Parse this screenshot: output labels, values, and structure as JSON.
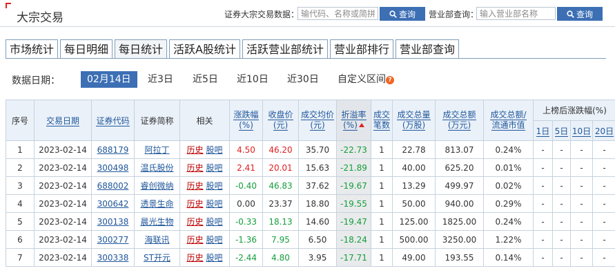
{
  "header": {
    "title": "大宗交易",
    "search1_label": "证券大宗交易数据：",
    "search1_placeholder": "输代码、名称或简拼",
    "search1_button": "查询",
    "search2_label": "营业部查询：",
    "search2_placeholder": "输入营业部名称",
    "search2_button": "查询"
  },
  "tabs": [
    {
      "label": "市场统计",
      "active": false
    },
    {
      "label": "每日明细",
      "active": false
    },
    {
      "label": "每日统计",
      "active": true
    },
    {
      "label": "活跃A股统计",
      "active": false
    },
    {
      "label": "活跃营业部统计",
      "active": false
    },
    {
      "label": "营业部排行",
      "active": false
    },
    {
      "label": "营业部查询",
      "active": false
    }
  ],
  "date_filter": {
    "label": "数据日期：",
    "options": [
      "02月14日",
      "近3日",
      "近5日",
      "近10日",
      "近30日",
      "自定义区间"
    ],
    "selected": "02月14日"
  },
  "table": {
    "headers": {
      "seq": "序号",
      "date": "交易日期",
      "code": "证券代码",
      "name": "证券简称",
      "related": "相关",
      "change": "涨跌幅\n(%)",
      "close": "收盘价\n(元)",
      "avg_price": "成交均价\n(元)",
      "discount": "折溢率\n(%)",
      "deals": "成交\n笔数",
      "volume": "成交总量\n(万股)",
      "amount": "成交总额\n(万元)",
      "ratio": "成交总额/\n流通市值",
      "post": "上榜后涨跌幅(%)",
      "post_1d": "1日",
      "post_5d": "5日",
      "post_10d": "10日",
      "post_20d": "20日"
    },
    "rows": [
      {
        "seq": "1",
        "date": "2023-02-14",
        "code": "688179",
        "name": "阿拉丁",
        "hist": "历史",
        "guba": "股吧",
        "change": "4.50",
        "close": "46.20",
        "avg": "35.70",
        "discount": "-22.73",
        "deals": "1",
        "volume": "22.78",
        "amount": "813.07",
        "ratio": "0.24%",
        "d1": "-",
        "d5": "-",
        "d10": "-",
        "d20": "-",
        "dir": "up"
      },
      {
        "seq": "2",
        "date": "2023-02-14",
        "code": "300498",
        "name": "温氏股份",
        "hist": "历史",
        "guba": "股吧",
        "change": "2.41",
        "close": "20.01",
        "avg": "15.63",
        "discount": "-21.89",
        "deals": "1",
        "volume": "40.00",
        "amount": "625.20",
        "ratio": "0.01%",
        "d1": "-",
        "d5": "-",
        "d10": "-",
        "d20": "-",
        "dir": "up"
      },
      {
        "seq": "3",
        "date": "2023-02-14",
        "code": "688002",
        "name": "睿创微纳",
        "hist": "历史",
        "guba": "股吧",
        "change": "-0.40",
        "close": "46.83",
        "avg": "37.62",
        "discount": "-19.67",
        "deals": "1",
        "volume": "13.29",
        "amount": "499.97",
        "ratio": "0.02%",
        "d1": "-",
        "d5": "-",
        "d10": "-",
        "d20": "-",
        "dir": "down"
      },
      {
        "seq": "4",
        "date": "2023-02-14",
        "code": "300642",
        "name": "透景生命",
        "hist": "历史",
        "guba": "股吧",
        "change": "0.00",
        "close": "23.37",
        "avg": "18.80",
        "discount": "-19.55",
        "deals": "1",
        "volume": "50.00",
        "amount": "940.00",
        "ratio": "0.29%",
        "d1": "-",
        "d5": "-",
        "d10": "-",
        "d20": "-",
        "dir": "flat"
      },
      {
        "seq": "5",
        "date": "2023-02-14",
        "code": "300138",
        "name": "晨光生物",
        "hist": "历史",
        "guba": "股吧",
        "change": "-0.33",
        "close": "18.13",
        "avg": "14.60",
        "discount": "-19.47",
        "deals": "1",
        "volume": "125.00",
        "amount": "1825.00",
        "ratio": "0.24%",
        "d1": "-",
        "d5": "-",
        "d10": "-",
        "d20": "-",
        "dir": "down"
      },
      {
        "seq": "6",
        "date": "2023-02-14",
        "code": "300277",
        "name": "海联讯",
        "hist": "历史",
        "guba": "股吧",
        "change": "-1.36",
        "close": "7.95",
        "avg": "6.50",
        "discount": "-18.24",
        "deals": "1",
        "volume": "500.00",
        "amount": "3250.00",
        "ratio": "1.22%",
        "d1": "-",
        "d5": "-",
        "d10": "-",
        "d20": "-",
        "dir": "down"
      },
      {
        "seq": "7",
        "date": "2023-02-14",
        "code": "300338",
        "name": "ST开元",
        "hist": "历史",
        "guba": "股吧",
        "change": "-2.44",
        "close": "4.80",
        "avg": "3.95",
        "discount": "-17.71",
        "deals": "1",
        "volume": "49.00",
        "amount": "193.55",
        "ratio": "0.14%",
        "d1": "-",
        "d5": "-",
        "d10": "-",
        "d20": "-",
        "dir": "down"
      }
    ]
  },
  "colors": {
    "accent": "#3c6fb4",
    "up": "#e02020",
    "down": "#139e3b",
    "link": "#20579b",
    "header_bg": "#eaf1f9"
  }
}
